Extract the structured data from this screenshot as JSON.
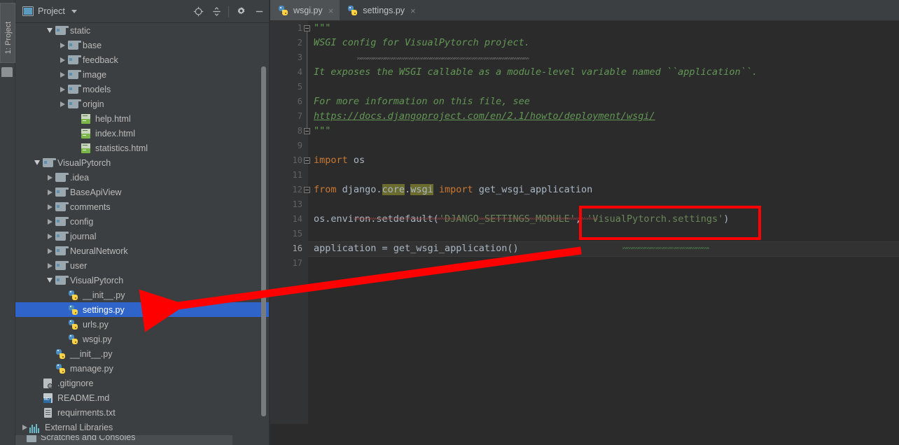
{
  "tool_strip": {
    "label": "1: Project"
  },
  "project_panel": {
    "title": "Project",
    "icons": {
      "panel": "project-icon",
      "caret": "chevron-down-icon",
      "locate": "locate-target-icon",
      "collapse": "collapse-all-icon",
      "settings": "gear-icon",
      "hide": "minimize-icon"
    },
    "tree": [
      {
        "label": "static",
        "indent": 2,
        "twisty": "down",
        "icon": "folder-module",
        "selected": false
      },
      {
        "label": "base",
        "indent": 3,
        "twisty": "right",
        "icon": "folder-module",
        "selected": false
      },
      {
        "label": "feedback",
        "indent": 3,
        "twisty": "right",
        "icon": "folder-module",
        "selected": false
      },
      {
        "label": "image",
        "indent": 3,
        "twisty": "right",
        "icon": "folder-module",
        "selected": false
      },
      {
        "label": "models",
        "indent": 3,
        "twisty": "right",
        "icon": "folder-module",
        "selected": false
      },
      {
        "label": "origin",
        "indent": 3,
        "twisty": "right",
        "icon": "folder-module",
        "selected": false
      },
      {
        "label": "help.html",
        "indent": 4,
        "twisty": "none",
        "icon": "html-file",
        "selected": false
      },
      {
        "label": "index.html",
        "indent": 4,
        "twisty": "none",
        "icon": "html-file",
        "selected": false
      },
      {
        "label": "statistics.html",
        "indent": 4,
        "twisty": "none",
        "icon": "html-file",
        "selected": false
      },
      {
        "label": "VisualPytorch",
        "indent": 1,
        "twisty": "down",
        "icon": "folder-module",
        "selected": false
      },
      {
        "label": ".idea",
        "indent": 2,
        "twisty": "right",
        "icon": "folder-plain",
        "selected": false
      },
      {
        "label": "BaseApiView",
        "indent": 2,
        "twisty": "right",
        "icon": "folder-module",
        "selected": false
      },
      {
        "label": "comments",
        "indent": 2,
        "twisty": "right",
        "icon": "folder-module",
        "selected": false
      },
      {
        "label": "config",
        "indent": 2,
        "twisty": "right",
        "icon": "folder-module",
        "selected": false
      },
      {
        "label": "journal",
        "indent": 2,
        "twisty": "right",
        "icon": "folder-module",
        "selected": false
      },
      {
        "label": "NeuralNetwork",
        "indent": 2,
        "twisty": "right",
        "icon": "folder-module",
        "selected": false
      },
      {
        "label": "user",
        "indent": 2,
        "twisty": "right",
        "icon": "folder-module",
        "selected": false
      },
      {
        "label": "VisualPytorch",
        "indent": 2,
        "twisty": "down",
        "icon": "folder-module",
        "selected": false
      },
      {
        "label": "__init__.py",
        "indent": 3,
        "twisty": "none",
        "icon": "python-file",
        "selected": false
      },
      {
        "label": "settings.py",
        "indent": 3,
        "twisty": "none",
        "icon": "python-file",
        "selected": true
      },
      {
        "label": "urls.py",
        "indent": 3,
        "twisty": "none",
        "icon": "python-file",
        "selected": false
      },
      {
        "label": "wsgi.py",
        "indent": 3,
        "twisty": "none",
        "icon": "python-file",
        "selected": false
      },
      {
        "label": "__init__.py",
        "indent": 2,
        "twisty": "none",
        "icon": "python-file",
        "selected": false
      },
      {
        "label": "manage.py",
        "indent": 2,
        "twisty": "none",
        "icon": "python-file",
        "selected": false
      },
      {
        "label": ".gitignore",
        "indent": 1,
        "twisty": "none",
        "icon": "gitignore-file",
        "selected": false
      },
      {
        "label": "README.md",
        "indent": 1,
        "twisty": "none",
        "icon": "markdown-file",
        "selected": false
      },
      {
        "label": "requirments.txt",
        "indent": 1,
        "twisty": "none",
        "icon": "text-file",
        "selected": false
      },
      {
        "label": "External Libraries",
        "indent": 0,
        "twisty": "right",
        "icon": "libraries",
        "selected": false
      }
    ],
    "bottom_row": {
      "label": "Scratches and Consoles"
    }
  },
  "editor": {
    "tabs": [
      {
        "label": "wsgi.py",
        "active": true,
        "icon": "python-file",
        "close": "×"
      },
      {
        "label": "settings.py",
        "active": false,
        "icon": "python-file",
        "close": "×"
      }
    ],
    "line_numbers": [
      "1",
      "2",
      "3",
      "4",
      "5",
      "6",
      "7",
      "8",
      "9",
      "10",
      "11",
      "12",
      "13",
      "14",
      "15",
      "16",
      "17"
    ],
    "caret_line": 16,
    "code": {
      "l1": "\"\"\"",
      "l2": "WSGI config for VisualPytorch project.",
      "l4": "It exposes the WSGI callable as a module-level variable named ``application``.",
      "l6": "For more information on this file, see",
      "l7": "https://docs.djangoproject.com/en/2.1/howto/deployment/wsgi/",
      "l8": "\"\"\"",
      "l10_kw": "import",
      "l10_rest": " os",
      "l12_kw1": "from",
      "l12_mod": " django.",
      "l12_hl1": "core",
      "l12_dot": ".",
      "l12_hl2": "wsgi",
      "l12_kw2": " import ",
      "l12_rest": "get_wsgi_application",
      "l14_a": "os.environ.setdefault(",
      "l14_s1": "'DJANGO_SETTINGS_MODULE'",
      "l14_c": ", ",
      "l14_s2": "'VisualPytorch.settings'",
      "l14_d": ")",
      "l16": "application = get_wsgi_application()"
    }
  },
  "annotations": {
    "red_box_target": "'VisualPytorch.settings')",
    "arrow_target": "settings.py",
    "color": "#ff0000"
  }
}
